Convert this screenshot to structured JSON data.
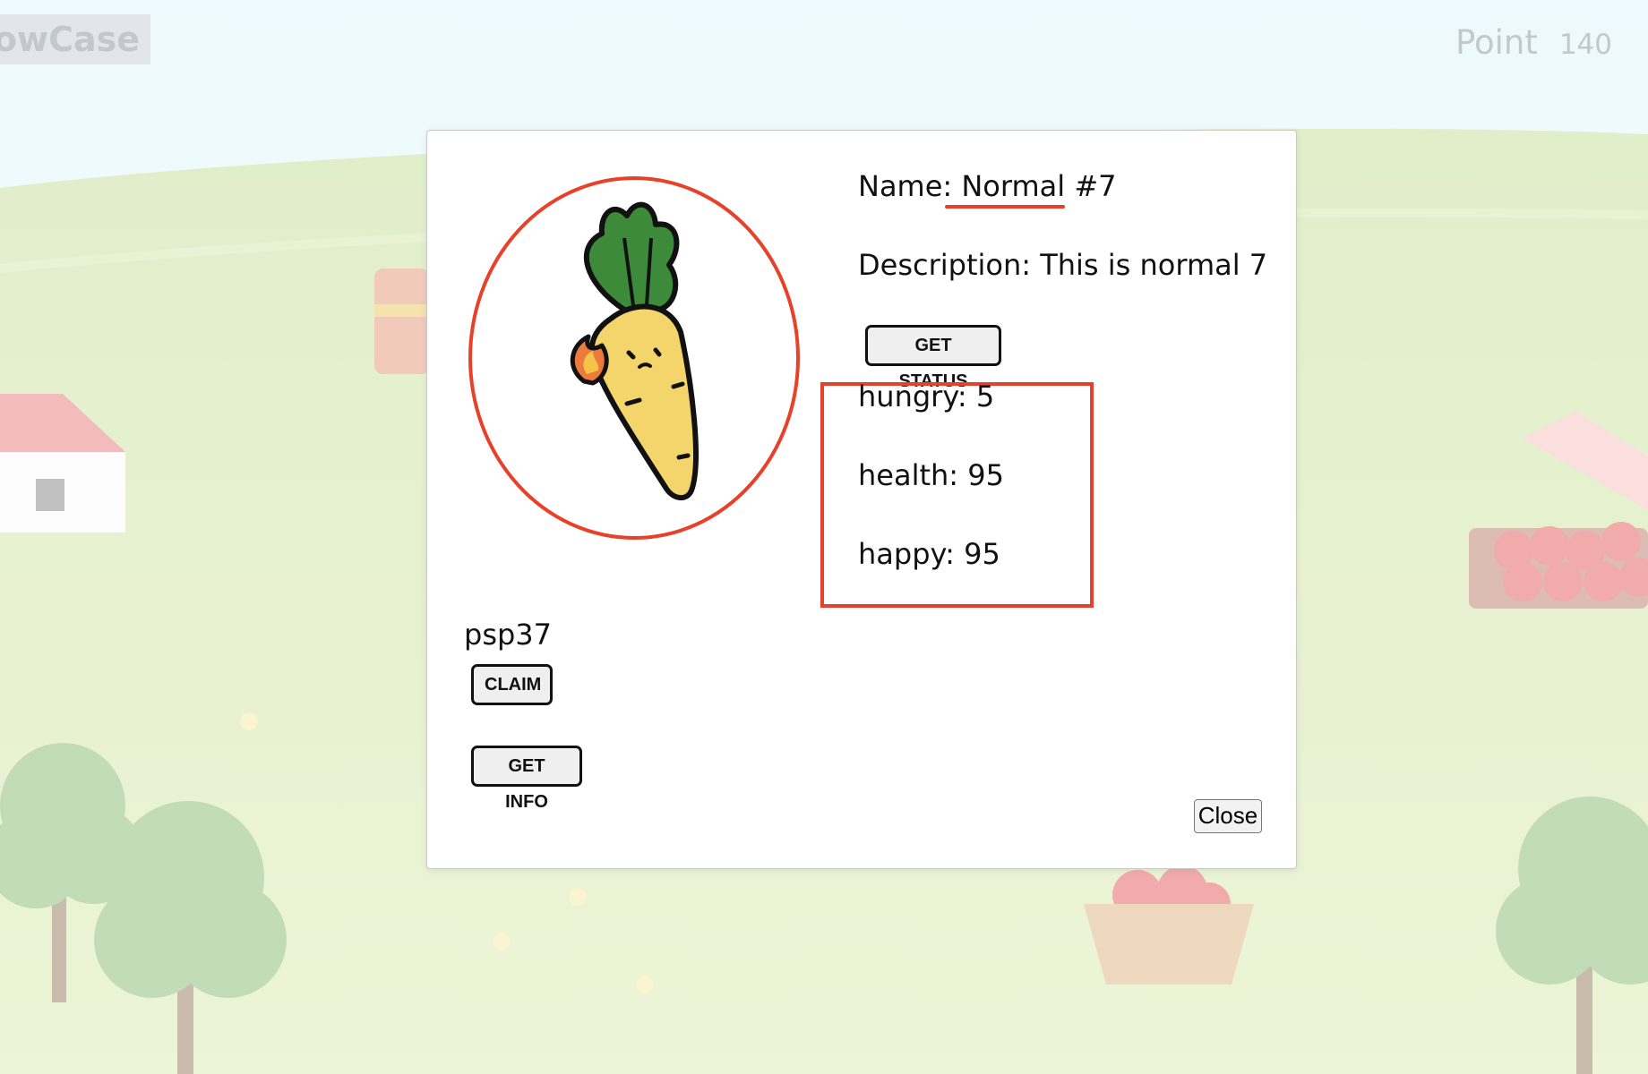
{
  "header": {
    "showcase_label": "ShowCase",
    "points_label": "Point",
    "points_value": "140"
  },
  "modal": {
    "name_label": "Name: Normal #7",
    "description": "Description: This is normal 7",
    "get_status_label": "GET STATUS",
    "status": {
      "hungry": "hungry: 5",
      "health": "health: 95",
      "happy": "happy: 95"
    },
    "owner": "psp37",
    "claim_label": "CLAIM",
    "get_info_label": "GET INFO",
    "close_label": "Close"
  },
  "colors": {
    "highlight": "#e8412a",
    "sky_top": "#d8f2fc",
    "grass": "#cfe39d"
  },
  "icons": {
    "character": "carrot-character-icon"
  }
}
